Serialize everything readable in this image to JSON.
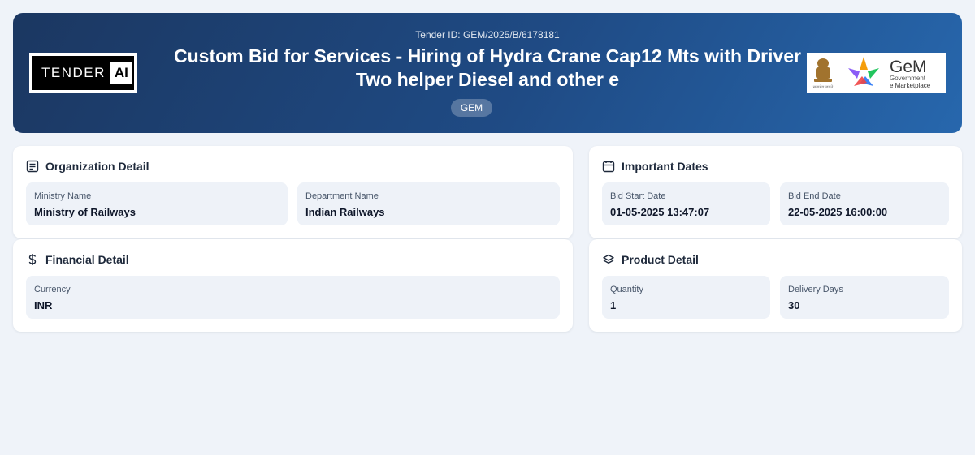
{
  "header": {
    "tender_id": "Tender ID: GEM/2025/B/6178181",
    "title": "Custom Bid for Services - Hiring of Hydra Crane Cap12 Mts with Driver Two helper Diesel and other e",
    "badge": "GEM",
    "logo_left": {
      "word1": "TENDER",
      "word2": "AI"
    },
    "logo_right": {
      "brand": "GeM",
      "line1": "Government",
      "line2": "e Marketplace",
      "emblem_caption": "सत्यमेव जयते"
    }
  },
  "organization": {
    "title": "Organization Detail",
    "icon": "list-icon",
    "fields": [
      {
        "label": "Ministry Name",
        "value": "Ministry of Railways"
      },
      {
        "label": "Department Name",
        "value": "Indian Railways"
      }
    ]
  },
  "dates": {
    "title": "Important Dates",
    "icon": "calendar-icon",
    "fields": [
      {
        "label": "Bid Start Date",
        "value": "01-05-2025 13:47:07"
      },
      {
        "label": "Bid End Date",
        "value": "22-05-2025 16:00:00"
      }
    ]
  },
  "financial": {
    "title": "Financial Detail",
    "icon": "dollar-icon",
    "fields": [
      {
        "label": "Currency",
        "value": "INR"
      }
    ]
  },
  "product": {
    "title": "Product Detail",
    "icon": "layers-icon",
    "fields": [
      {
        "label": "Quantity",
        "value": "1"
      },
      {
        "label": "Delivery Days",
        "value": "30"
      }
    ]
  },
  "colors": {
    "header_start": "#1b3761",
    "header_end": "#2767ad",
    "page_bg": "#eff3f9",
    "field_bg": "#eef2f8"
  }
}
